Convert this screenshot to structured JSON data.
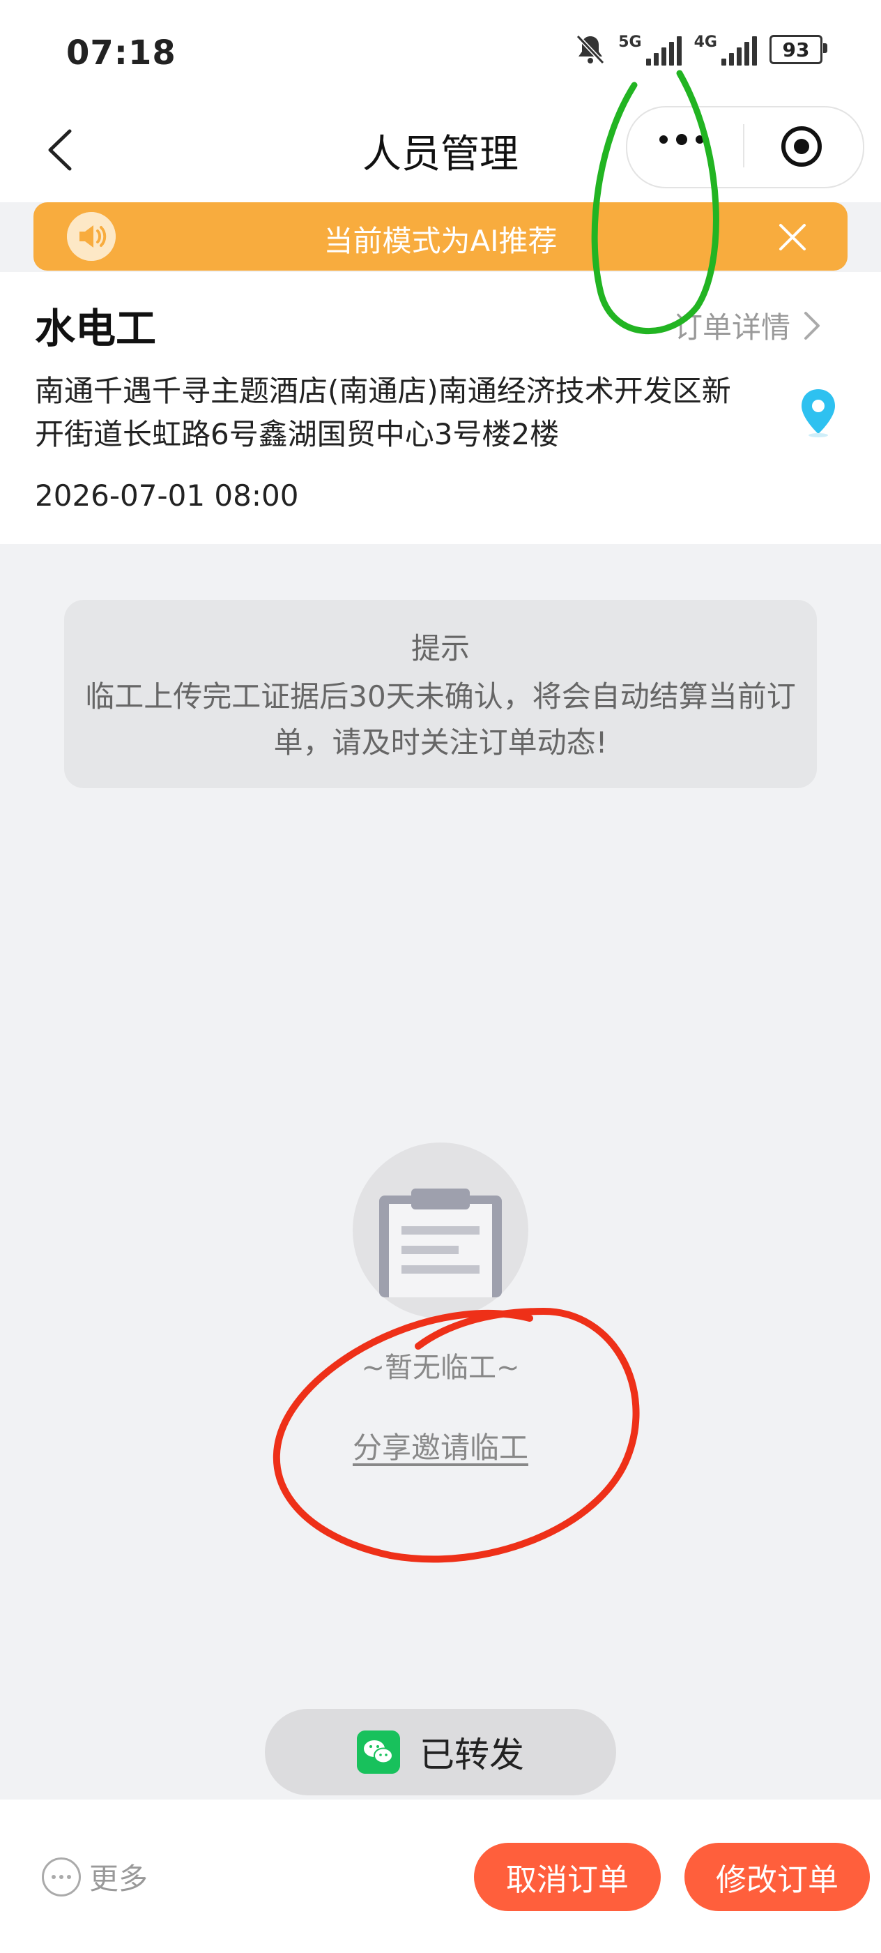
{
  "status_bar": {
    "time": "07:18",
    "net1": "5G",
    "net2": "4G",
    "battery": "93"
  },
  "nav": {
    "title": "人员管理"
  },
  "banner": {
    "text": "当前模式为AI推荐"
  },
  "order": {
    "job_title": "水电工",
    "detail_link": "订单详情",
    "address": "南通千遇千寻主题酒店(南通店)南通经济技术开发区新开街道长虹路6号鑫湖国贸中心3号楼2楼",
    "datetime": "2026-07-01 08:00"
  },
  "notice": {
    "title": "提示",
    "body": "临工上传完工证据后30天未确认，将会自动结算当前订单，请及时关注订单动态!"
  },
  "empty_state": {
    "text": "~暂无临工~",
    "share_link": "分享邀请临工"
  },
  "forwarded": {
    "label": "已转发"
  },
  "bottom_bar": {
    "more_label": "更多",
    "cancel_label": "取消订单",
    "edit_label": "修改订单"
  },
  "colors": {
    "banner": "#f8ac3e",
    "primary_button": "#ff5f3c",
    "wechat": "#18c15c",
    "pin": "#2ec1f0"
  }
}
